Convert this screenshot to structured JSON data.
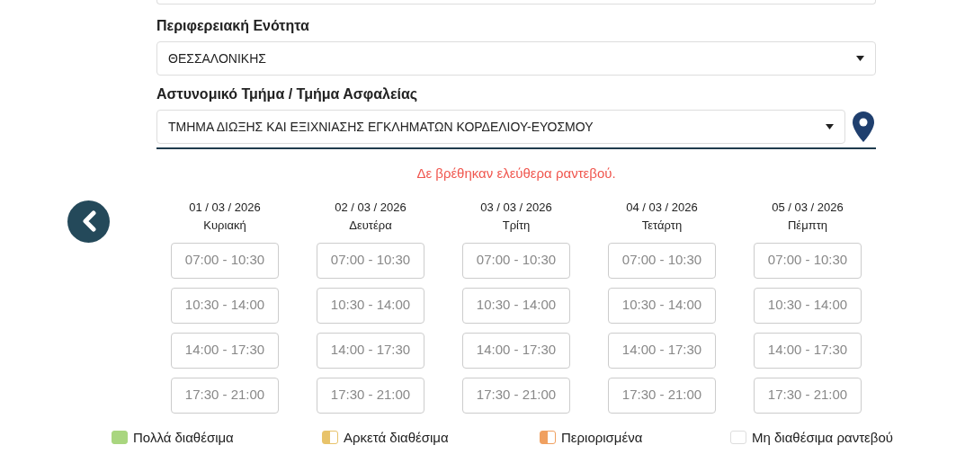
{
  "form": {
    "fields": [
      {
        "label": "Περιφερειακή Ενότητα",
        "value": "ΘΕΣΣΑΛΟΝΙΚΗΣ",
        "location_button": false
      },
      {
        "label": "Αστυνομικό Τμήμα / Τμήμα Ασφαλείας",
        "value": "ΤΜΗΜΑ ΔΙΩΞΗΣ ΚΑΙ ΕΞΙΧΝΙΑΣΗΣ ΕΓΚΛΗΜΑΤΩΝ ΚΟΡΔΕΛΙΟΥ-ΕΥΟΣΜΟΥ",
        "location_button": true
      }
    ]
  },
  "message": "Δε βρέθηκαν ελεύθερα ραντεβού.",
  "days": [
    {
      "date": "01 / 03 / 2026",
      "weekday": "Κυριακή",
      "slots": [
        "07:00 - 10:30",
        "10:30 - 14:00",
        "14:00 - 17:30",
        "17:30 - 21:00"
      ]
    },
    {
      "date": "02 / 03 / 2026",
      "weekday": "Δευτέρα",
      "slots": [
        "07:00 - 10:30",
        "10:30 - 14:00",
        "14:00 - 17:30",
        "17:30 - 21:00"
      ]
    },
    {
      "date": "03 / 03 / 2026",
      "weekday": "Τρίτη",
      "slots": [
        "07:00 - 10:30",
        "10:30 - 14:00",
        "14:00 - 17:30",
        "17:30 - 21:00"
      ]
    },
    {
      "date": "04 / 03 / 2026",
      "weekday": "Τετάρτη",
      "slots": [
        "07:00 - 10:30",
        "10:30 - 14:00",
        "14:00 - 17:30",
        "17:30 - 21:00"
      ]
    },
    {
      "date": "05 / 03 / 2026",
      "weekday": "Πέμπτη",
      "slots": [
        "07:00 - 10:30",
        "10:30 - 14:00",
        "14:00 - 17:30",
        "17:30 - 21:00"
      ]
    }
  ],
  "legend": [
    {
      "label": "Πολλά διαθέσιμα",
      "kind": "full",
      "color": "#a9d67f"
    },
    {
      "label": "Αρκετά διαθέσιμα",
      "kind": "half",
      "color": "#e8c36a"
    },
    {
      "label": "Περιορισμένα",
      "kind": "half",
      "color": "#f0a060"
    },
    {
      "label": "Μη διαθέσιμα ραντεβού",
      "kind": "empty",
      "color": "#dddddd"
    }
  ]
}
